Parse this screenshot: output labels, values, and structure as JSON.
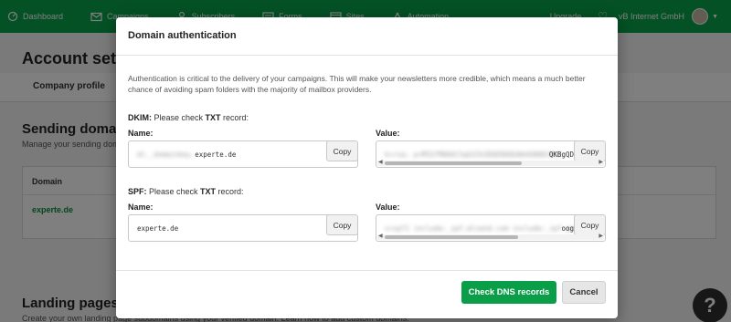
{
  "nav": {
    "items": [
      {
        "label": "Dashboard",
        "icon": "dashboard-icon"
      },
      {
        "label": "Campaigns",
        "icon": "mail-icon"
      },
      {
        "label": "Subscribers",
        "icon": "user-icon"
      },
      {
        "label": "Forms",
        "icon": "forms-icon"
      },
      {
        "label": "Sites",
        "icon": "sites-icon"
      },
      {
        "label": "Automation",
        "icon": "automation-icon"
      }
    ],
    "upgrade": "Upgrade",
    "account": "vB Internet GmbH"
  },
  "page": {
    "title": "Account settings",
    "tab": "Company profile",
    "sending_title": "Sending domains",
    "sending_sub": "Manage your sending domains",
    "table_header": "Domain",
    "table_row": "experte.de",
    "landing_title": "Landing pages",
    "landing_sub": "Create your own landing page subdomains using your verified domain. Learn how to add custom domains."
  },
  "modal": {
    "title": "Domain authentication",
    "intro": "Authentication is critical to the delivery of your campaigns. This will make your newsletters more credible, which means a much better chance of avoiding spam folders with the majority of mailbox providers.",
    "dkim": {
      "prefix": "DKIM:",
      "text": " Please check ",
      "type": "TXT",
      "suffix": " record:",
      "name_label": "Name:",
      "value_label": "Value:",
      "name_hidden": "ml._domainkey.",
      "name_visible": "experte.de",
      "value_hidden": "k=rsa; p=MIGfMA0GCSqGSIb3DQEBAQUAA4GNADCBiQ",
      "value_tail": "QKBgQD"
    },
    "spf": {
      "prefix": "SPF:",
      "text": " Please check ",
      "type": "TXT",
      "suffix": " record:",
      "name_label": "Name:",
      "value_label": "Value:",
      "name_value": "experte.de",
      "value_hidden": "v=spf1 include:_spf.mlsend.com include:_spf.google.",
      "value_tail": "oog"
    },
    "copy_label": "Copy",
    "check_button": "Check DNS records",
    "cancel_button": "Cancel"
  },
  "help": "?",
  "colors": {
    "brand_green": "#09a34b",
    "button_green": "#0a9e49"
  }
}
